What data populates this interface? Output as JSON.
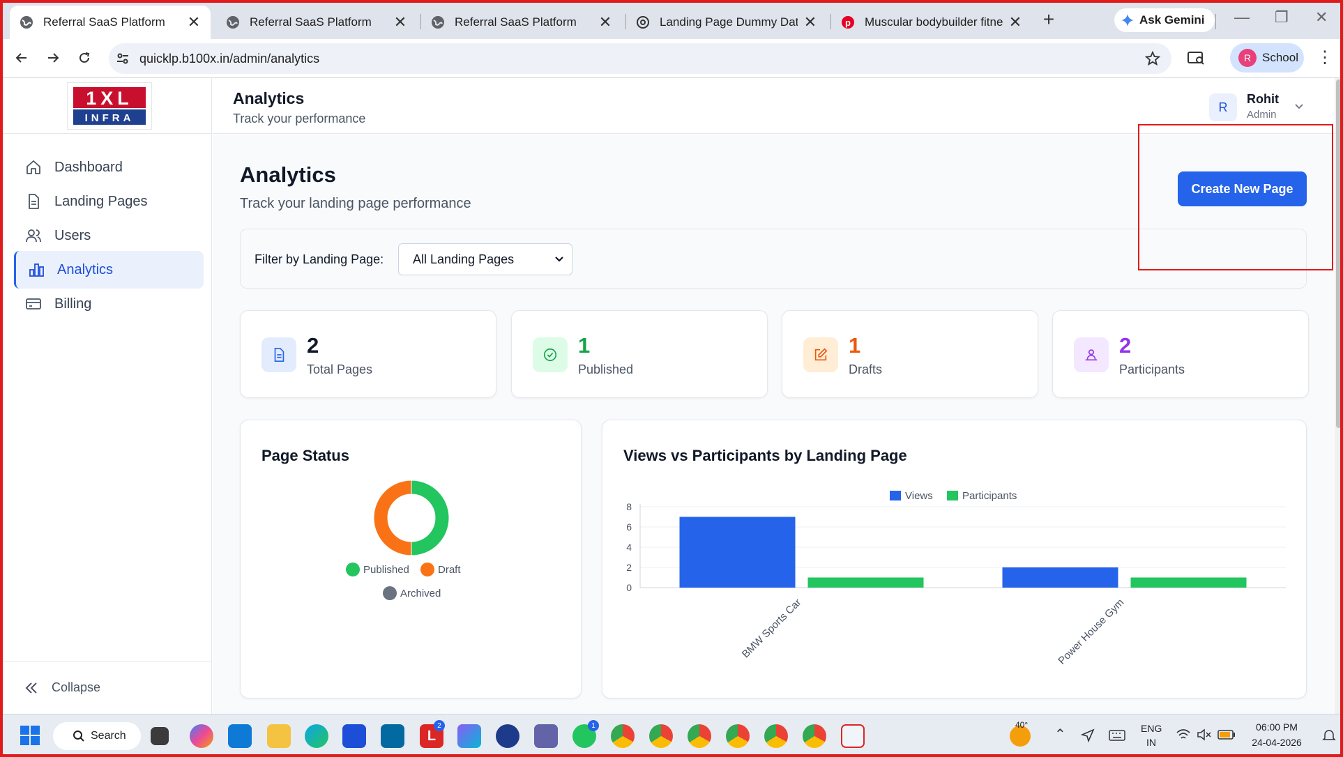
{
  "browser": {
    "tabs": [
      {
        "title": "Referral SaaS Platform",
        "active": true
      },
      {
        "title": "Referral SaaS Platform",
        "active": false
      },
      {
        "title": "Referral SaaS Platform",
        "active": false
      },
      {
        "title": "Landing Page Dummy Data",
        "active": false
      },
      {
        "title": "Muscular bodybuilder fitness n",
        "active": false
      }
    ],
    "gemini_label": "Ask Gemini",
    "url": "quicklp.b100x.in/admin/analytics",
    "profile_initial": "R",
    "profile_label": "School"
  },
  "sidebar": {
    "logo_top": "1XL",
    "logo_bottom": "INFRA",
    "items": [
      {
        "label": "Dashboard",
        "icon": "home-icon"
      },
      {
        "label": "Landing Pages",
        "icon": "document-icon"
      },
      {
        "label": "Users",
        "icon": "users-icon"
      },
      {
        "label": "Analytics",
        "icon": "bar-chart-icon",
        "active": true
      },
      {
        "label": "Billing",
        "icon": "credit-card-icon"
      }
    ],
    "collapse_label": "Collapse"
  },
  "topbar": {
    "title": "Analytics",
    "subtitle": "Track your performance",
    "user_initial": "R",
    "user_name": "Rohit",
    "user_role": "Admin"
  },
  "page": {
    "title": "Analytics",
    "subtitle": "Track your landing page performance",
    "create_button": "Create New Page",
    "filter_label": "Filter by Landing Page:",
    "filter_value": "All Landing Pages"
  },
  "stats": [
    {
      "value": "2",
      "label": "Total Pages",
      "color": "#111827",
      "icon": "document-icon",
      "bg": "#e3ecfd",
      "ic": "#2563eb"
    },
    {
      "value": "1",
      "label": "Published",
      "color": "#16a34a",
      "icon": "check-circle-icon",
      "bg": "#dcfce7",
      "ic": "#16a34a"
    },
    {
      "value": "1",
      "label": "Drafts",
      "color": "#ea580c",
      "icon": "edit-icon",
      "bg": "#ffedd5",
      "ic": "#ea580c"
    },
    {
      "value": "2",
      "label": "Participants",
      "color": "#9333ea",
      "icon": "participants-icon",
      "bg": "#f3e8ff",
      "ic": "#9333ea"
    }
  ],
  "page_status": {
    "title": "Page Status",
    "legend": [
      {
        "label": "Published",
        "color": "#22c55e"
      },
      {
        "label": "Draft",
        "color": "#f97316"
      },
      {
        "label": "Archived",
        "color": "#6b7280"
      }
    ]
  },
  "views_chart": {
    "title": "Views vs Participants by Landing Page"
  },
  "chart_data": [
    {
      "type": "pie",
      "title": "Page Status",
      "categories": [
        "Published",
        "Draft",
        "Archived"
      ],
      "values": [
        1,
        1,
        0
      ],
      "colors": [
        "#22c55e",
        "#f97316",
        "#6b7280"
      ],
      "legend": "bottom"
    },
    {
      "type": "bar",
      "title": "Views vs Participants by Landing Page",
      "categories": [
        "BMW Sports Car",
        "Power House Gym"
      ],
      "series": [
        {
          "name": "Views",
          "values": [
            7,
            2
          ],
          "color": "#2563eb"
        },
        {
          "name": "Participants",
          "values": [
            1,
            1
          ],
          "color": "#22c55e"
        }
      ],
      "ylim": [
        0,
        8
      ],
      "yticks": [
        "0",
        "2",
        "4",
        "6",
        "8"
      ],
      "grid": true,
      "legend": "top-center"
    }
  ],
  "taskbar": {
    "search_label": "Search",
    "weather": "40°",
    "lang_top": "ENG",
    "lang_bottom": "IN",
    "time": "06:00 PM",
    "date": "24-04-2026",
    "badges": [
      "2",
      "1"
    ]
  }
}
